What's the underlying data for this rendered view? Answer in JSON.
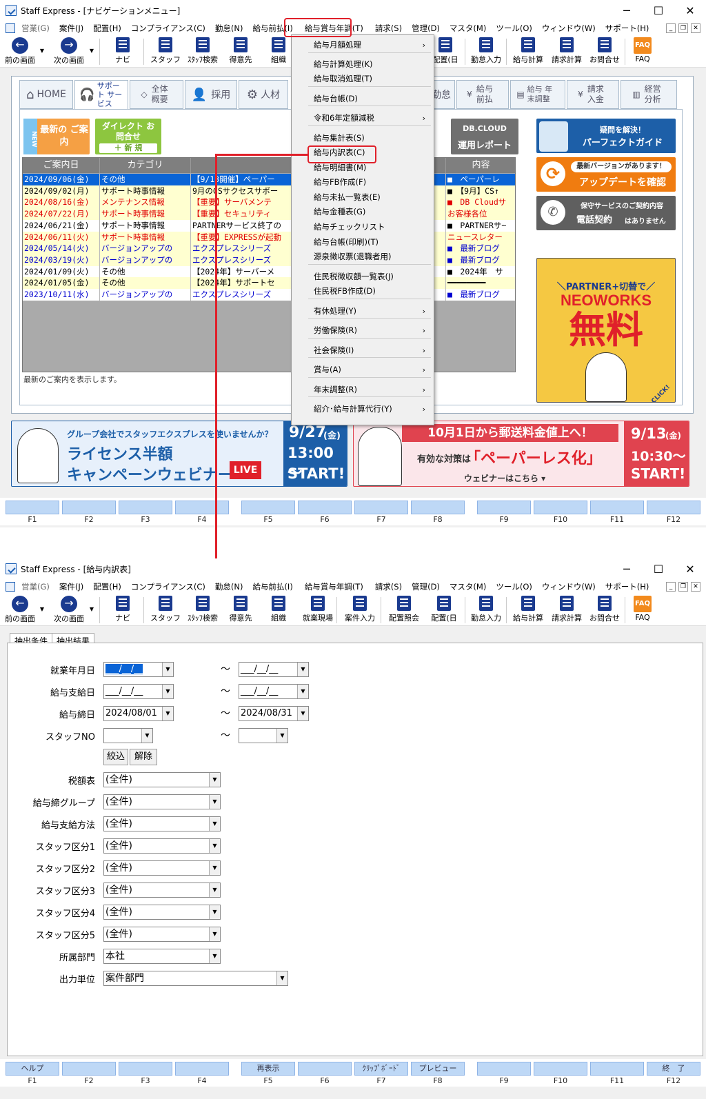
{
  "top_window": {
    "title": "Staff Express - [ナビゲーションメニュー]",
    "menu": [
      "営業(G)",
      "案件(J)",
      "配置(H)",
      "コンプライアンス(C)",
      "勤怠(N)",
      "給与前払(I)",
      "給与賞与年調(T)",
      "請求(S)",
      "管理(D)",
      "マスタ(M)",
      "ツール(O)",
      "ウィンドウ(W)",
      "サポート(H)"
    ],
    "toolbar": [
      "前の画面",
      "次の画面",
      "ナビ",
      "スタッフ",
      "ｽﾀｯﾌ検索",
      "得意先",
      "組織",
      "配置(日",
      "勤怠入力",
      "給与計算",
      "請求計算",
      "お問合せ",
      "FAQ"
    ],
    "nav_tabs": [
      "HOME",
      "サポート サービス",
      "全体 概要",
      "採用",
      "人材",
      "勤怠",
      "給与 前払",
      "給与 年末調整",
      "請求 入金",
      "経営 分析"
    ],
    "news_buttons": {
      "new": "NEW",
      "latest": "最新の ご案内",
      "direct": "ダイレクト お問合せ",
      "new_reg": "＋ 新 規",
      "dbcloud": "DB.CLOUD",
      "report": "運用レポート"
    },
    "grid_headers": [
      "ご案内日",
      "カテゴリ",
      "内容"
    ],
    "grid_rows": [
      {
        "date": "2024/09/06(金)",
        "cat": "その他",
        "title": "【9/13開催】ペーパー",
        "c": "■　ペーパーレ",
        "color": "#fff",
        "sel": true
      },
      {
        "date": "2024/09/02(月)",
        "cat": "サポート時事情報",
        "title": "9月のCSサクセスサポー",
        "c": "■　【9月】CS↑",
        "color": "#000",
        "bg": "#ffffd0"
      },
      {
        "date": "2024/08/16(金)",
        "cat": "メンテナンス情報",
        "title": "【重要】サーバメンテ",
        "c": "■　DB Cloudサ",
        "color": "#e00000",
        "bg": "#ffffd0"
      },
      {
        "date": "2024/07/22(月)",
        "cat": "サポート時事情報",
        "title": "【重要】セキュリティ",
        "c": "お客様各位",
        "color": "#e00000",
        "bg": "#ffffd0"
      },
      {
        "date": "2024/06/21(金)",
        "cat": "サポート時事情報",
        "title": "PARTNERサービス終了の",
        "c": "■　PARTNERサ~",
        "color": "#000",
        "bg": "#fff"
      },
      {
        "date": "2024/06/11(火)",
        "cat": "サポート時事情報",
        "title": "【重要】EXPRESSが起動",
        "c": "ニュースレター",
        "color": "#e00000",
        "bg": "#ffffd0"
      },
      {
        "date": "2024/05/14(火)",
        "cat": "バージョンアップの",
        "title": "エクスプレスシリーズ",
        "c": "■　最新ブログ",
        "color": "#0000d0",
        "bg": "#ffffd0"
      },
      {
        "date": "2024/03/19(火)",
        "cat": "バージョンアップの",
        "title": "エクスプレスシリーズ",
        "c": "■　最新ブログ",
        "color": "#0000d0",
        "bg": "#ffffd0"
      },
      {
        "date": "2024/01/09(火)",
        "cat": "その他",
        "title": "【2024年】サーバーメ",
        "c": "■　2024年　サ",
        "color": "#000",
        "bg": "#fff"
      },
      {
        "date": "2024/01/05(金)",
        "cat": "その他",
        "title": "【2024年】サポートセ",
        "c": "━━━━━━━━",
        "color": "#000",
        "bg": "#ffffd0"
      },
      {
        "date": "2023/10/11(水)",
        "cat": "バージョンアップの",
        "title": "エクスプレスシリーズ",
        "c": "■　最新ブログ",
        "color": "#0000d0",
        "bg": "#fff"
      }
    ],
    "grid_status": "最新のご案内を表示します。",
    "dropdown": [
      "給与月額処理",
      "給与計算処理(K)",
      "給与取消処理(T)",
      "給与台帳(D)",
      "令和6年定額減税",
      "給与集計表(S)",
      "給与内訳表(C)",
      "給与明細書(M)",
      "給与FB作成(F)",
      "給与未払一覧表(E)",
      "給与金種表(G)",
      "給与チェックリスト",
      "給与台帳(印刷)(T)",
      "源泉徴収票(退職者用)",
      "住民税徴収額一覧表(J)",
      "住民税FB作成(D)",
      "有休処理(Y)",
      "労働保険(R)",
      "社会保険(I)",
      "賞与(A)",
      "年末調整(R)",
      "紹介･給与計算代行(Y)"
    ],
    "side_ads": {
      "guide_top": "疑問を解決！",
      "guide": "パーフェクトガイド",
      "update_top": "最新バージョンがあります！",
      "update": "アップデートを確認",
      "hoshu_top": "保守サービスのご契約内容",
      "hoshu": "電話契約",
      "hoshu_sub": "はありません",
      "neo_top": "＼PARTNER+切替で／",
      "neo": "NEOWORKS",
      "free": "無料",
      "click": "CLICK!"
    },
    "banner1": {
      "top": "グループ会社でスタッフエクスプレスを使いませんか？",
      "main1": "ライセンス半額",
      "main2": "キャンペーンウェビナー",
      "live": "LIVE",
      "date": "9/27",
      "dow": "(金)",
      "time": "13:00～",
      "start": "START!"
    },
    "banner2": {
      "top": "10月1日から郵送料金値上へ！",
      "mid": "有効な対策は",
      "key": "「ペーパーレス化」",
      "bottom": "ウェビナーはこちら ▾",
      "date": "9/13",
      "dow": "(金)",
      "time": "10:30～",
      "start": "START!"
    },
    "fkeys": [
      "F1",
      "F2",
      "F3",
      "F4",
      "F5",
      "F6",
      "F7",
      "F8",
      "F9",
      "F10",
      "F11",
      "F12"
    ]
  },
  "bottom_window": {
    "title": "Staff Express - [給与内訳表]",
    "toolbar": [
      "前の画面",
      "次の画面",
      "ナビ",
      "スタッフ",
      "ｽﾀｯﾌ検索",
      "得意先",
      "組織",
      "就業現場",
      "案件入力",
      "配置照会",
      "配置(日",
      "勤怠入力",
      "給与計算",
      "請求計算",
      "お問合せ",
      "FAQ"
    ],
    "tabs": [
      "抽出条件",
      "抽出結果"
    ],
    "labels": {
      "work_ym": "就業年月日",
      "pay_date": "給与支給日",
      "close_date": "給与締日",
      "staff_no": "スタッフNO",
      "tax_table": "税額表",
      "close_group": "給与締グループ",
      "pay_method": "給与支給方法",
      "kubun1": "スタッフ区分1",
      "kubun2": "スタッフ区分2",
      "kubun3": "スタッフ区分3",
      "kubun4": "スタッフ区分4",
      "kubun5": "スタッフ区分5",
      "dept": "所属部門",
      "output_unit": "出力単位"
    },
    "values": {
      "work_from": "___/__/__",
      "work_to": "___/__/__",
      "pay_from": "___/__/__",
      "pay_to": "___/__/__",
      "close_from": "2024/08/01",
      "close_to": "2024/08/31",
      "all": "(全件)",
      "dept": "本社",
      "output_unit": "案件部門"
    },
    "tilde": "～",
    "buttons": {
      "filter": "絞込",
      "clear": "解除"
    },
    "fkey_labels": [
      "ヘルプ",
      "",
      "",
      "",
      "再表示",
      "",
      "ｸﾘｯﾌﾟﾎﾞｰﾄﾞ",
      "プレビュー",
      "",
      "",
      "",
      "終　了"
    ],
    "fkeys": [
      "F1",
      "F2",
      "F3",
      "F4",
      "F5",
      "F6",
      "F7",
      "F8",
      "F9",
      "F10",
      "F11",
      "F12"
    ]
  },
  "colors": {
    "accent": "#1a3a8f",
    "highlight": "#e0202a",
    "fkey": "#bed8f6",
    "select": "#0a64d6"
  }
}
